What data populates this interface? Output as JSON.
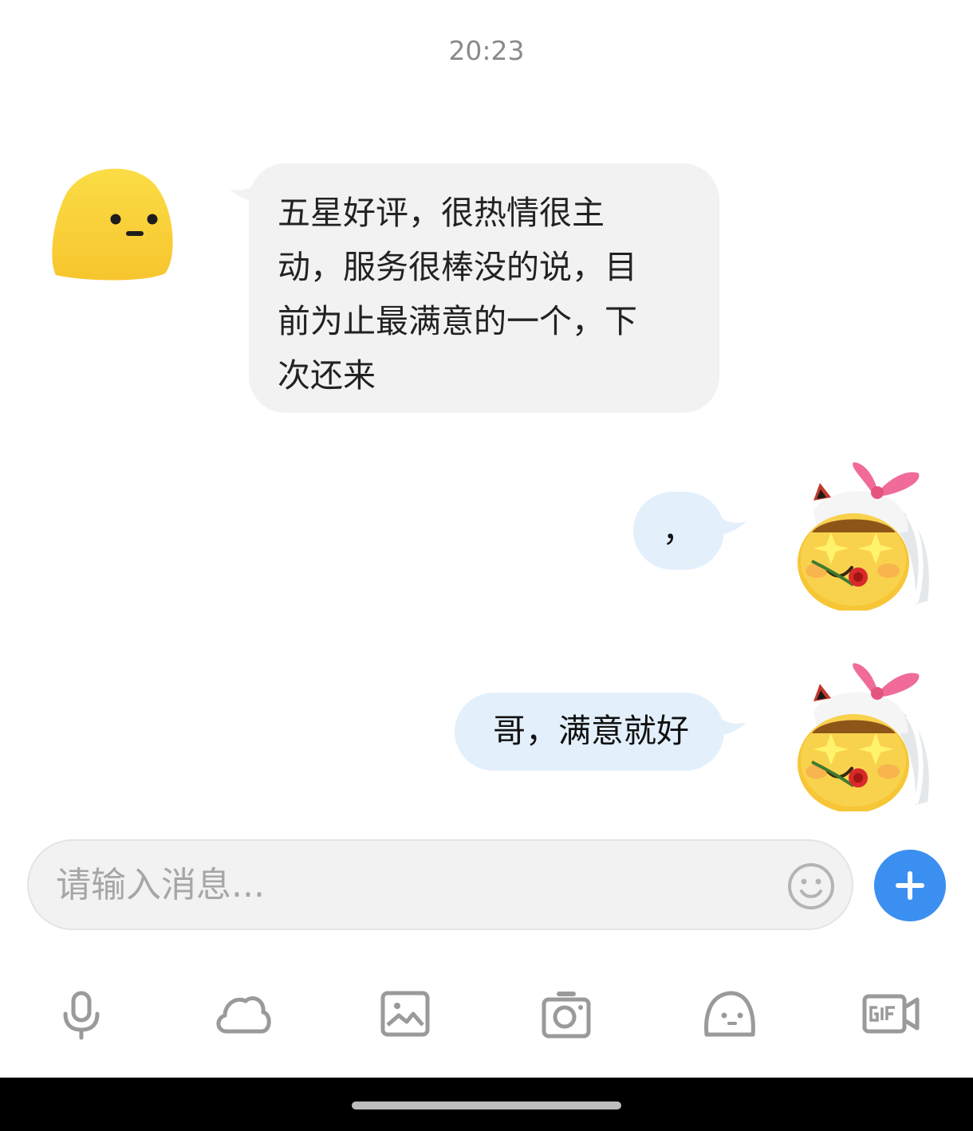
{
  "status": {
    "time": "20:23"
  },
  "messages": [
    {
      "side": "left",
      "avatar_icon": "yellow-blob-neutral-icon",
      "lines": [
        "五星好评，很热情很主",
        "动，服务很棒没的说，目",
        "前为止最满意的一个，下",
        "次还来"
      ]
    },
    {
      "side": "right",
      "avatar_icon": "cat-ribbon-star-eyes-icon",
      "text": "，"
    },
    {
      "side": "right",
      "avatar_icon": "cat-ribbon-star-eyes-icon",
      "text": "哥，满意就好"
    }
  ],
  "composer": {
    "placeholder": "请输入消息..."
  },
  "toolbar": [
    "microphone-icon",
    "cloud-icon",
    "image-icon",
    "camera-icon",
    "sticker-face-icon",
    "gif-icon"
  ],
  "colors": {
    "accent": "#3b8ff0",
    "incoming_bubble": "#f2f2f2",
    "outgoing_bubble": "#e3f0fc"
  }
}
